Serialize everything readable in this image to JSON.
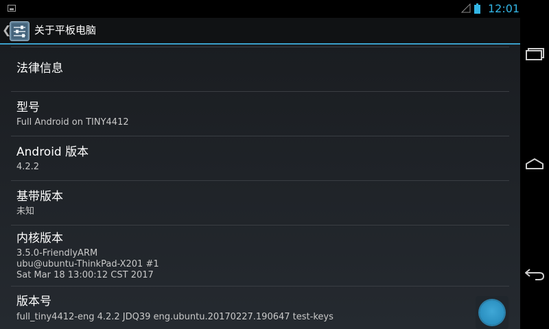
{
  "status_bar": {
    "time": "12:01",
    "icons": [
      "notification-image-icon",
      "signal-icon",
      "battery-icon"
    ],
    "accent_color": "#33b5e5"
  },
  "action_bar": {
    "title": "关于平板电脑",
    "icons": [
      "back-chevron-icon",
      "settings-sliders-icon"
    ]
  },
  "preferences": [
    {
      "title": "法律信息",
      "summary": []
    },
    {
      "title": "型号",
      "summary": [
        "Full Android on TINY4412"
      ]
    },
    {
      "title": "Android 版本",
      "summary": [
        "4.2.2"
      ]
    },
    {
      "title": "基带版本",
      "summary": [
        "未知"
      ]
    },
    {
      "title": "内核版本",
      "summary": [
        "3.5.0-FriendlyARM",
        "ubu@ubuntu-ThinkPad-X201 #1",
        "Sat Mar 18 13:00:12 CST 2017"
      ]
    },
    {
      "title": "版本号",
      "summary": [
        "full_tiny4412-eng 4.2.2 JDQ39 eng.ubuntu.20170227.190647 test-keys"
      ]
    }
  ],
  "nav_bar": {
    "buttons": [
      "recent-apps-icon",
      "home-icon",
      "back-icon"
    ]
  },
  "floating_button": {
    "icon": "assistive-touch-icon",
    "color": "#3fa7d6"
  }
}
